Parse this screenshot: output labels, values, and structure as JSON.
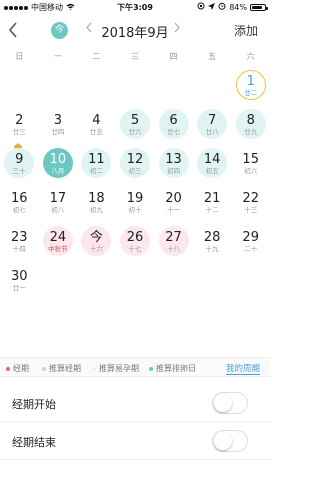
{
  "status_bar": {
    "carrier": "中国移动",
    "time": "下午3:09",
    "battery": "84%",
    "battery_level": 0.84
  },
  "header": {
    "back_icon": "chevron-left-icon",
    "today_label": "今",
    "prev_icon": "chevron-left",
    "month_title": "2018年9月",
    "next_icon": "chevron-right",
    "add_label": "添加"
  },
  "weekdays": [
    "日",
    "一",
    "二",
    "三",
    "四",
    "五",
    "六"
  ],
  "weeks": [
    [
      null,
      null,
      null,
      null,
      null,
      null,
      {
        "day": "1",
        "lunar": "廿二",
        "style": "outline"
      }
    ],
    [
      {
        "day": "2",
        "lunar": "廿三",
        "style": "",
        "marker": "pentagon"
      },
      {
        "day": "3",
        "lunar": "廿四",
        "style": ""
      },
      {
        "day": "4",
        "lunar": "廿五",
        "style": ""
      },
      {
        "day": "5",
        "lunar": "廿六",
        "style": "cyan"
      },
      {
        "day": "6",
        "lunar": "廿七",
        "style": "cyan"
      },
      {
        "day": "7",
        "lunar": "廿八",
        "style": "cyan"
      },
      {
        "day": "8",
        "lunar": "廿九",
        "style": "cyan"
      }
    ],
    [
      {
        "day": "9",
        "lunar": "三十",
        "style": "cyan"
      },
      {
        "day": "10",
        "lunar": "八月",
        "style": "today"
      },
      {
        "day": "11",
        "lunar": "初二",
        "style": "cyan"
      },
      {
        "day": "12",
        "lunar": "初三",
        "style": "cyan"
      },
      {
        "day": "13",
        "lunar": "初四",
        "style": "cyan"
      },
      {
        "day": "14",
        "lunar": "初五",
        "style": "cyan"
      },
      {
        "day": "15",
        "lunar": "初六",
        "style": ""
      }
    ],
    [
      {
        "day": "16",
        "lunar": "初七",
        "style": ""
      },
      {
        "day": "17",
        "lunar": "初八",
        "style": ""
      },
      {
        "day": "18",
        "lunar": "初九",
        "style": ""
      },
      {
        "day": "19",
        "lunar": "初十",
        "style": ""
      },
      {
        "day": "20",
        "lunar": "十一",
        "style": ""
      },
      {
        "day": "21",
        "lunar": "十二",
        "style": ""
      },
      {
        "day": "22",
        "lunar": "十三",
        "style": ""
      }
    ],
    [
      {
        "day": "23",
        "lunar": "十四",
        "style": ""
      },
      {
        "day": "24",
        "lunar": "中秋节",
        "style": "pink",
        "festival": true
      },
      {
        "day": "今",
        "lunar": "十六",
        "style": "pink"
      },
      {
        "day": "26",
        "lunar": "十七",
        "style": "pink"
      },
      {
        "day": "27",
        "lunar": "十八",
        "style": "pink"
      },
      {
        "day": "28",
        "lunar": "十九",
        "style": ""
      },
      {
        "day": "29",
        "lunar": "二十",
        "style": ""
      }
    ],
    [
      {
        "day": "30",
        "lunar": "廿一",
        "style": ""
      },
      null,
      null,
      null,
      null,
      null,
      null
    ]
  ],
  "legend": {
    "items": [
      {
        "label": "经期",
        "color": "#e8607a"
      },
      {
        "label": "推算经期",
        "color": "#f4c2cd"
      },
      {
        "label": "推算易孕期",
        "color": "#dff4f3"
      },
      {
        "label": "推算排卵日",
        "color": "#6fc7c3"
      }
    ],
    "mine_label": "我的周期"
  },
  "settings": [
    {
      "label": "经期开始",
      "on": false
    },
    {
      "label": "经期结束",
      "on": false
    }
  ]
}
